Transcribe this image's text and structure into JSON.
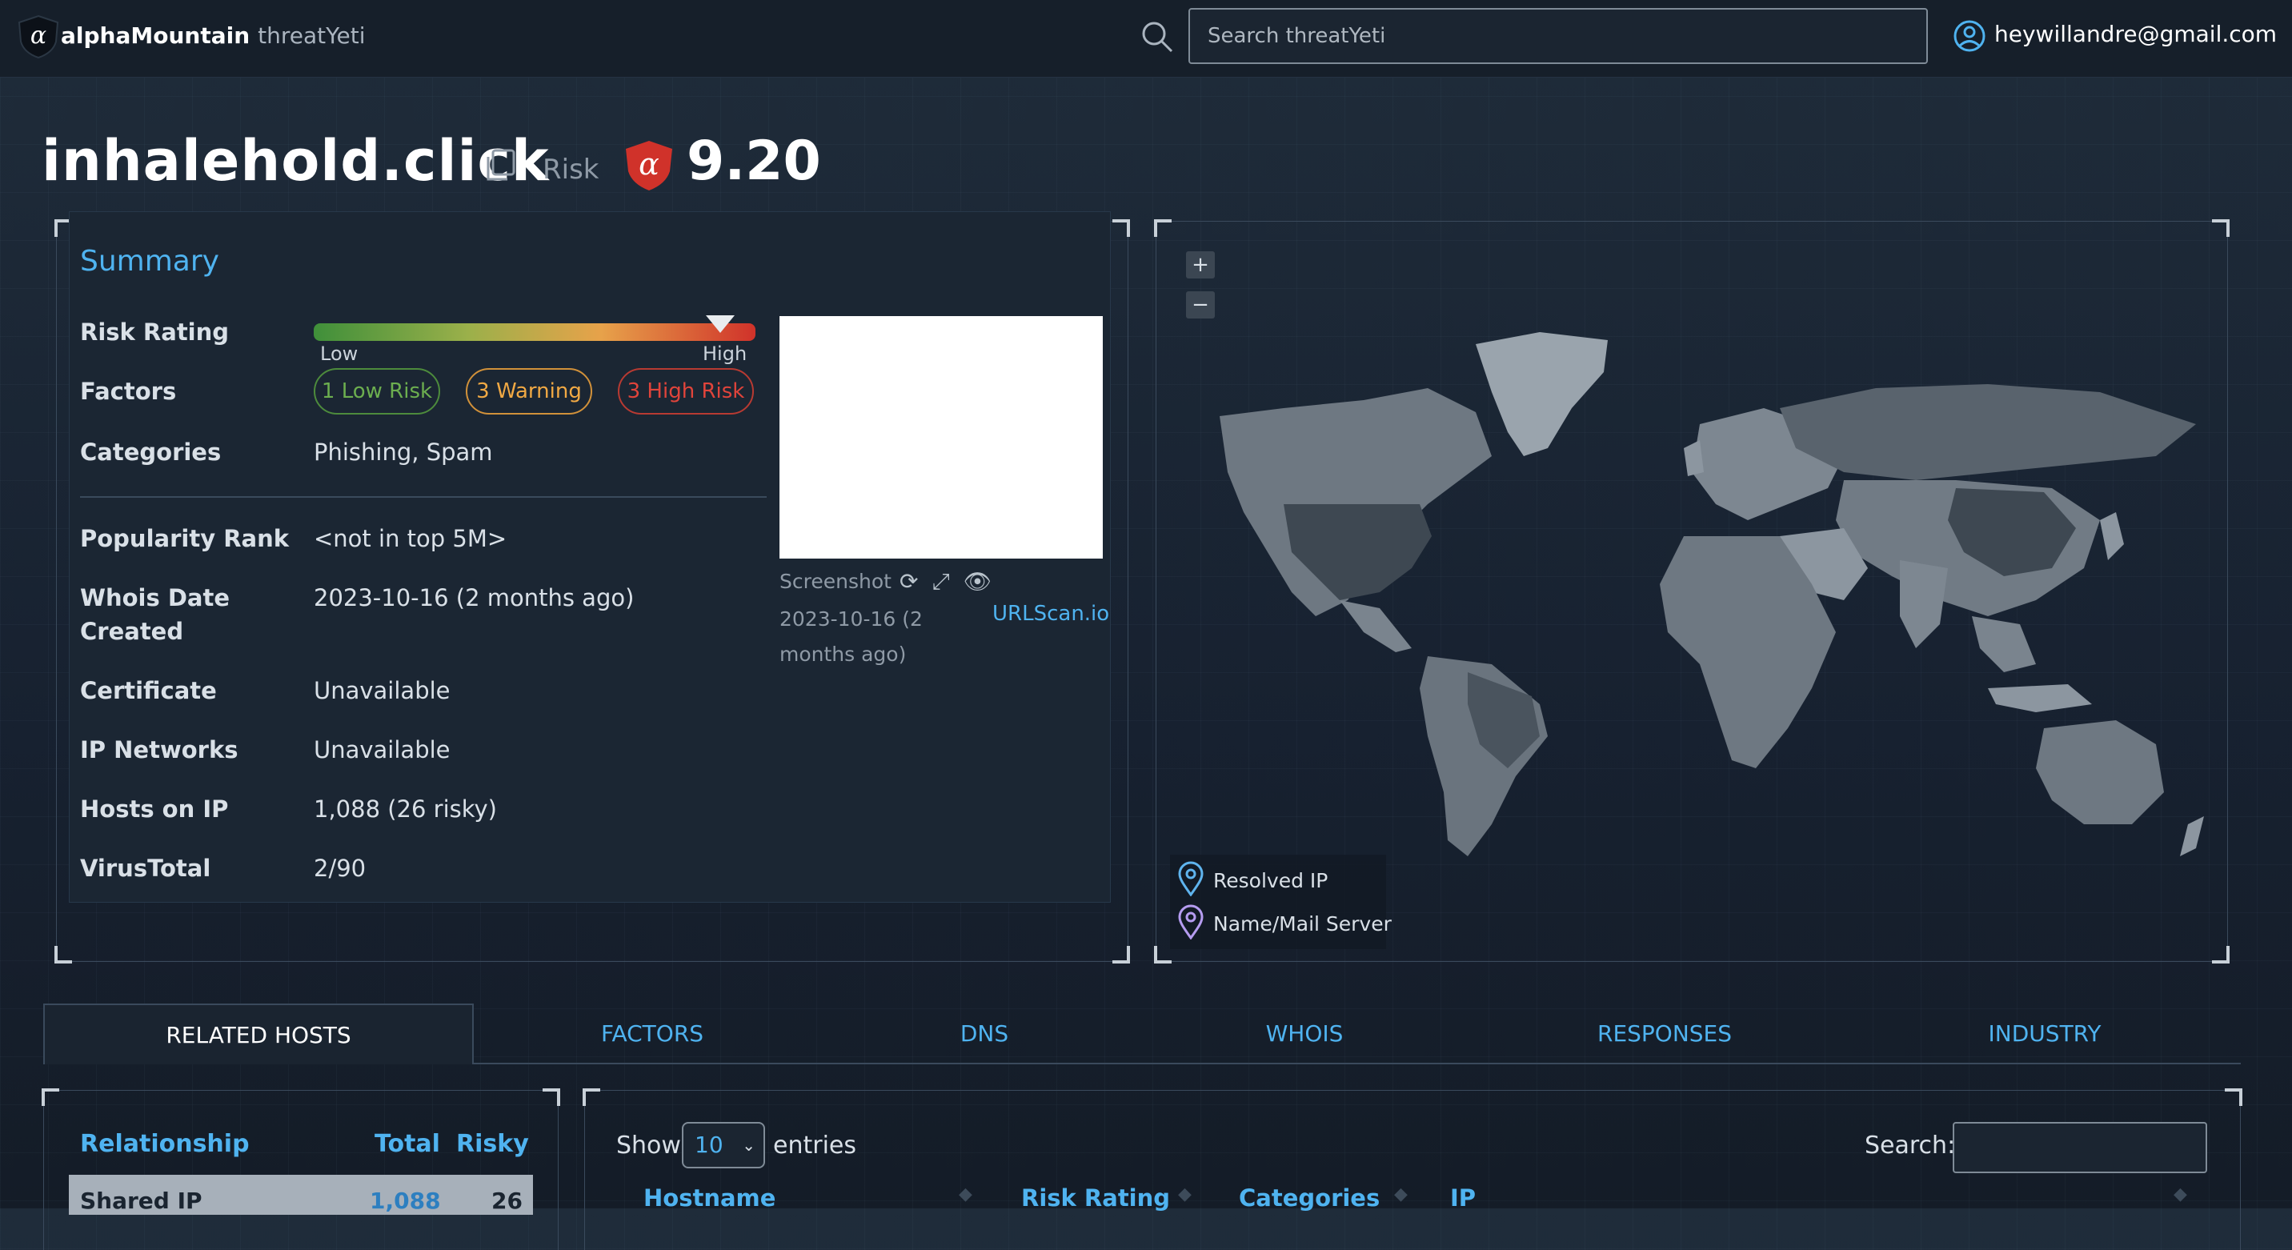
{
  "header": {
    "brand": "alphaMountain",
    "product": "threatYeti",
    "search_placeholder": "Search threatYeti",
    "user_email": "heywillandre@gmail.com"
  },
  "title": {
    "domain": "inhalehold.click",
    "risk_label": "Risk",
    "risk_score": "9.20"
  },
  "summary": {
    "heading": "Summary",
    "rows": [
      {
        "label": "Risk Rating",
        "value": ""
      },
      {
        "label": "Factors",
        "value": ""
      },
      {
        "label": "Categories",
        "value": "Phishing, Spam"
      },
      {
        "label": "Popularity Rank",
        "value": "<not in top 5M>"
      },
      {
        "label": "Whois Date Created",
        "value": "2023-10-16 (2 months ago)"
      },
      {
        "label": "Certificate",
        "value": "Unavailable"
      },
      {
        "label": "IP Networks",
        "value": "Unavailable"
      },
      {
        "label": "Hosts on IP",
        "value": "1,088 (26 risky)"
      },
      {
        "label": "VirusTotal",
        "value": "2/90"
      }
    ],
    "gauge": {
      "low": "Low",
      "high": "High",
      "level_fraction": 0.92
    },
    "factors": {
      "low": "1 Low Risk",
      "warning": "3 Warning",
      "high": "3 High Risk"
    },
    "screenshot": {
      "caption": "Screenshot",
      "date": "2023-10-16 (2 months ago)",
      "source_link": "URLScan.io"
    }
  },
  "map": {
    "zoom_in": "+",
    "zoom_out": "−",
    "legend": {
      "resolved": "Resolved IP",
      "name_mail": "Name/Mail Server"
    }
  },
  "tabs": [
    {
      "label": "RELATED HOSTS",
      "active": true
    },
    {
      "label": "FACTORS"
    },
    {
      "label": "DNS"
    },
    {
      "label": "WHOIS"
    },
    {
      "label": "RESPONSES"
    },
    {
      "label": "INDUSTRY"
    }
  ],
  "relationships": {
    "headers": [
      "Relationship",
      "Total",
      "Risky"
    ],
    "rows": [
      {
        "relationship": "Shared IP",
        "total": "1,088",
        "risky": "26"
      }
    ]
  },
  "hosts_table": {
    "show_label": "Show",
    "page_size": "10",
    "entries_label": "entries",
    "search_label": "Search:",
    "columns": [
      "Hostname",
      "Risk Rating",
      "Categories",
      "IP"
    ]
  },
  "colors": {
    "accent": "#4fb3f0",
    "low": "#6cae4f",
    "warning": "#f1a944",
    "high": "#e0443b"
  }
}
